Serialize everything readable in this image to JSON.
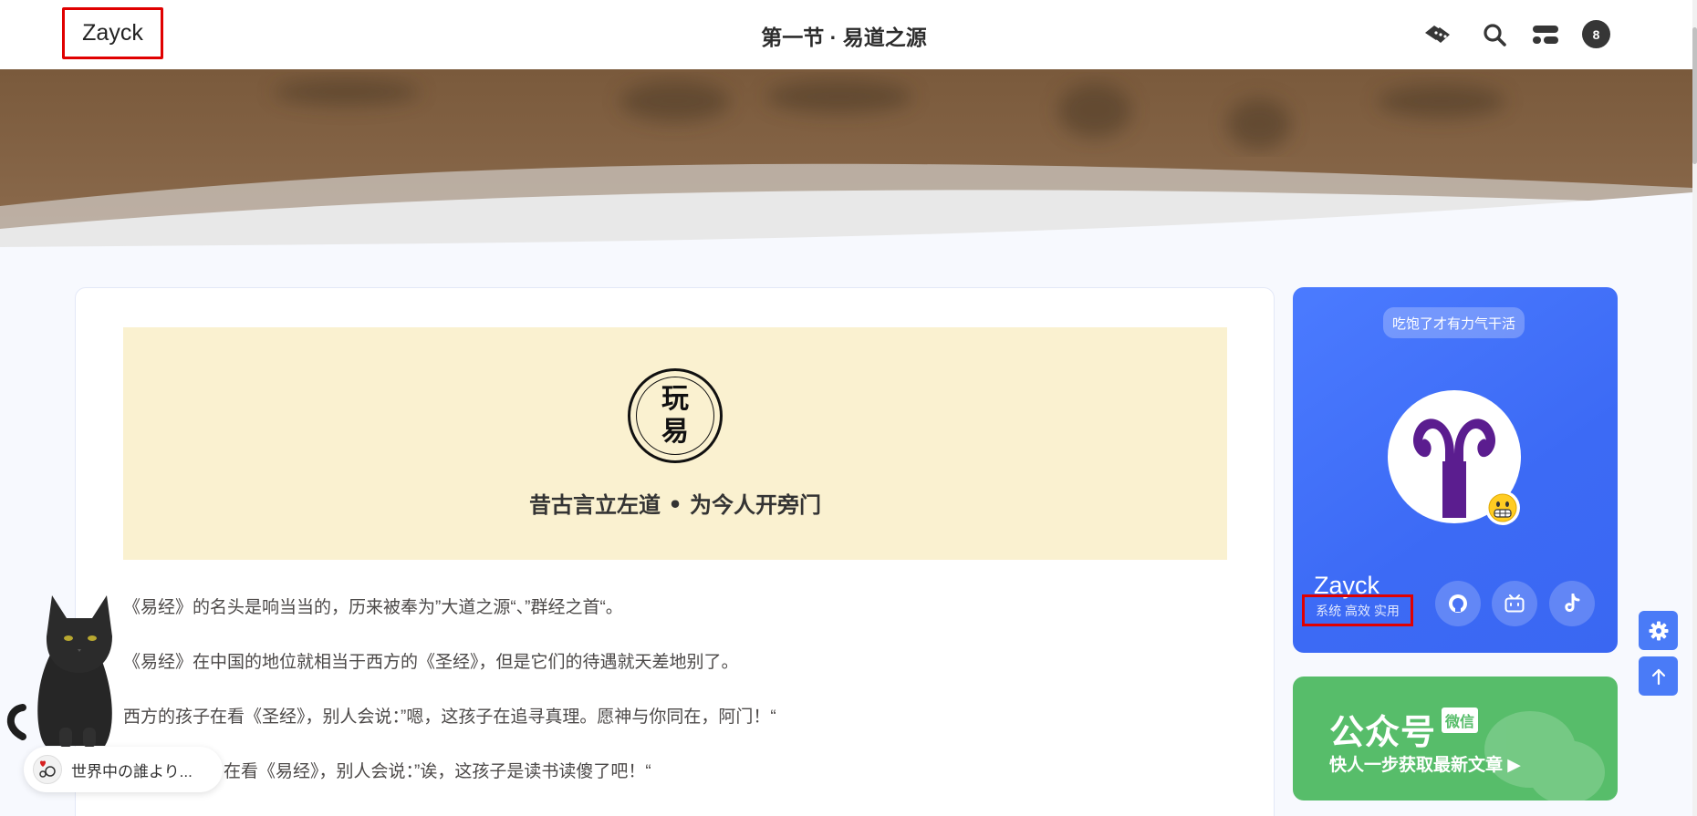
{
  "header": {
    "brand": "Zayck",
    "title": "第一节 · 易道之源",
    "count": "8"
  },
  "article": {
    "seal_chars": [
      "玩",
      "易"
    ],
    "motto": "昔古言立左道 • 为今人开旁门",
    "paragraphs": [
      "《易经》的名头是响当当的，历来被奉为”大道之源“、”群经之首“。",
      "《易经》在中国的地位就相当于西方的《圣经》，但是它们的待遇就天差地别了。",
      "西方的孩子在看《圣经》，别人会说：”嗯，这孩子在追寻真理。愿神与你同在，阿门！“",
      "在看《易经》，别人会说：”诶，这孩子是读书读傻了吧！“"
    ]
  },
  "profile": {
    "tagline": "吃饱了才有力气干活",
    "name": "Zayck",
    "subtitle": "系统 高效 实用",
    "socials": [
      "github-icon",
      "bilibili-icon",
      "tiktok-icon"
    ]
  },
  "wechat": {
    "title": "公众号",
    "badge": "微信",
    "subtitle": "快人一步获取最新文章 ▶"
  },
  "music": {
    "title": "世界中の誰より..."
  },
  "colors": {
    "accent": "#4a7bf7",
    "wechat": "#57bd6a",
    "cover": "#faf1d0",
    "banner": "#8a6848"
  }
}
